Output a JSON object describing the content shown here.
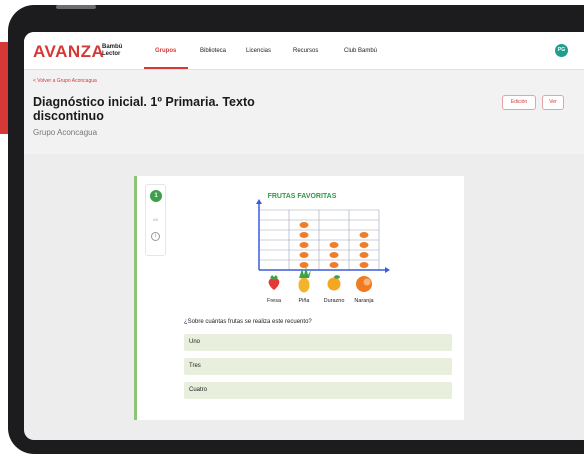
{
  "app": {
    "logo_main": "AVANZA",
    "logo_sub_line1": "Bambú",
    "logo_sub_line2": "Lector"
  },
  "nav": {
    "items": [
      {
        "label": "Grupos",
        "active": true
      },
      {
        "label": "Biblioteca",
        "active": false
      },
      {
        "label": "Licencias",
        "active": false
      },
      {
        "label": "Recursos",
        "active": false
      },
      {
        "label": "Club Bambú",
        "active": false
      }
    ],
    "avatar_initials": "PG"
  },
  "header": {
    "back_link": "< Volver a Grupo Aconcagua",
    "title": "Diagnóstico inicial. 1º Primaria. Texto discontinuo",
    "subtitle": "Grupo Aconcagua",
    "edit_button": "Edición",
    "view_button": "Ver"
  },
  "sidebar": {
    "question_number": "1",
    "small_label": "4/6",
    "info_icon": "info-icon"
  },
  "chart_data": {
    "type": "pictograph",
    "title": "FRUTAS FAVORITAS",
    "categories": [
      "Fresa",
      "Piña",
      "Durazno",
      "Naranja"
    ],
    "values": [
      0,
      5,
      3,
      4
    ],
    "ylim": [
      0,
      6
    ],
    "grid": true,
    "colors": {
      "axis": "#3b5bdb",
      "title": "#2e9a45",
      "marker": "#ef7d2a"
    }
  },
  "quiz": {
    "question": "¿Sobre cuántas frutas se realiza este recuento?",
    "options": [
      "Uno",
      "Tres",
      "Cuatro"
    ]
  },
  "colors": {
    "brand": "#d63838",
    "accent_green": "#8cc57a",
    "option_bg": "#e8efdc"
  }
}
